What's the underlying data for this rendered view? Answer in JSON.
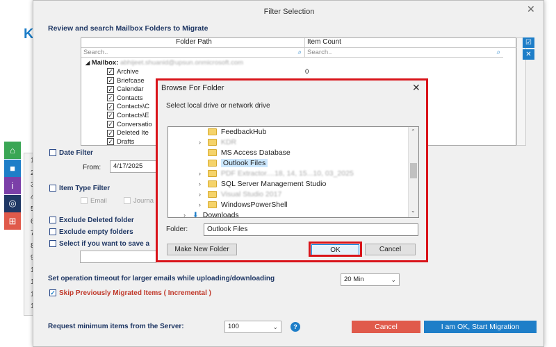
{
  "background": {
    "letter": "K",
    "row_numbers": [
      "1",
      "2",
      "3",
      "4",
      "5",
      "6",
      "7",
      "8",
      "9",
      "10",
      "11",
      "12",
      "13"
    ]
  },
  "sidebar_icons": [
    {
      "icon": "home-icon",
      "glyph": "⌂",
      "color": "#3aa655"
    },
    {
      "icon": "video-icon",
      "glyph": "■",
      "color": "#1e7ec8"
    },
    {
      "icon": "info-icon",
      "glyph": "i",
      "color": "#7b3fa8"
    },
    {
      "icon": "support-icon",
      "glyph": "◎",
      "color": "#1f3764"
    },
    {
      "icon": "cart-icon",
      "glyph": "⊞",
      "color": "#e05a4b"
    }
  ],
  "dialog": {
    "title": "Filter Selection",
    "close": "✕",
    "review_label": "Review and search Mailbox Folders to Migrate",
    "table": {
      "col_folder": "Folder Path",
      "col_count": "Item Count",
      "search_placeholder_1": "Search..",
      "search_placeholder_2": "Search..",
      "mailbox_label": "Mailbox:",
      "mailbox_value": "abhijeet.shuanid@upsun.onmicrosoft.com",
      "rows": [
        {
          "name": "Archive",
          "count": "0"
        },
        {
          "name": "Briefcase",
          "count": ""
        },
        {
          "name": "Calendar",
          "count": ""
        },
        {
          "name": "Contacts",
          "count": ""
        },
        {
          "name": "Contacts\\C",
          "count": ""
        },
        {
          "name": "Contacts\\E",
          "count": ""
        },
        {
          "name": "Conversatio",
          "count": ""
        },
        {
          "name": "Deleted Ite",
          "count": ""
        },
        {
          "name": "Drafts",
          "count": ""
        }
      ]
    },
    "date_filter": {
      "label": "Date Filter",
      "from_label": "From:",
      "from_value": "4/17/2025"
    },
    "item_type_filter": {
      "label": "Item Type Filter",
      "email": "Email",
      "journal": "Journa"
    },
    "exclude_deleted": "Exclude Deleted folder",
    "exclude_empty": "Exclude empty folders",
    "save_label": "Select if you want to save a",
    "timeout_label": "Set operation timeout for larger emails while uploading/downloading",
    "timeout_value": "20 Min",
    "skip_label": "Skip Previously Migrated Items ( Incremental )",
    "request_label": "Request minimum items from the Server:",
    "request_value": "100",
    "help": "?",
    "cancel_button": "Cancel",
    "ok_button": "I am OK, Start Migration"
  },
  "browse": {
    "title": "Browse For Folder",
    "close": "✕",
    "instruction": "Select local drive or network drive",
    "tree": [
      {
        "name": "FeedbackHub",
        "expander": "",
        "blurred": false,
        "selected": false,
        "icon": "folder"
      },
      {
        "name": "KDR",
        "expander": "›",
        "blurred": true,
        "selected": false,
        "icon": "folder"
      },
      {
        "name": "MS Access Database",
        "expander": "",
        "blurred": false,
        "selected": false,
        "icon": "folder"
      },
      {
        "name": "Outlook Files",
        "expander": "",
        "blurred": false,
        "selected": true,
        "icon": "folder"
      },
      {
        "name": "PDF Extractor....18, 14, 15...10, 03_2025",
        "expander": "›",
        "blurred": true,
        "selected": false,
        "icon": "folder"
      },
      {
        "name": "SQL Server Management Studio",
        "expander": "›",
        "blurred": false,
        "selected": false,
        "icon": "folder"
      },
      {
        "name": "Visual Studio 2017",
        "expander": "›",
        "blurred": true,
        "selected": false,
        "icon": "folder"
      },
      {
        "name": "WindowsPowerShell",
        "expander": "›",
        "blurred": false,
        "selected": false,
        "icon": "folder"
      },
      {
        "name": "Downloads",
        "expander": "›",
        "blurred": false,
        "selected": false,
        "icon": "download"
      }
    ],
    "folder_label": "Folder:",
    "folder_value": "Outlook Files",
    "new_folder_button": "Make New Folder",
    "ok_button": "OK",
    "cancel_button": "Cancel"
  }
}
